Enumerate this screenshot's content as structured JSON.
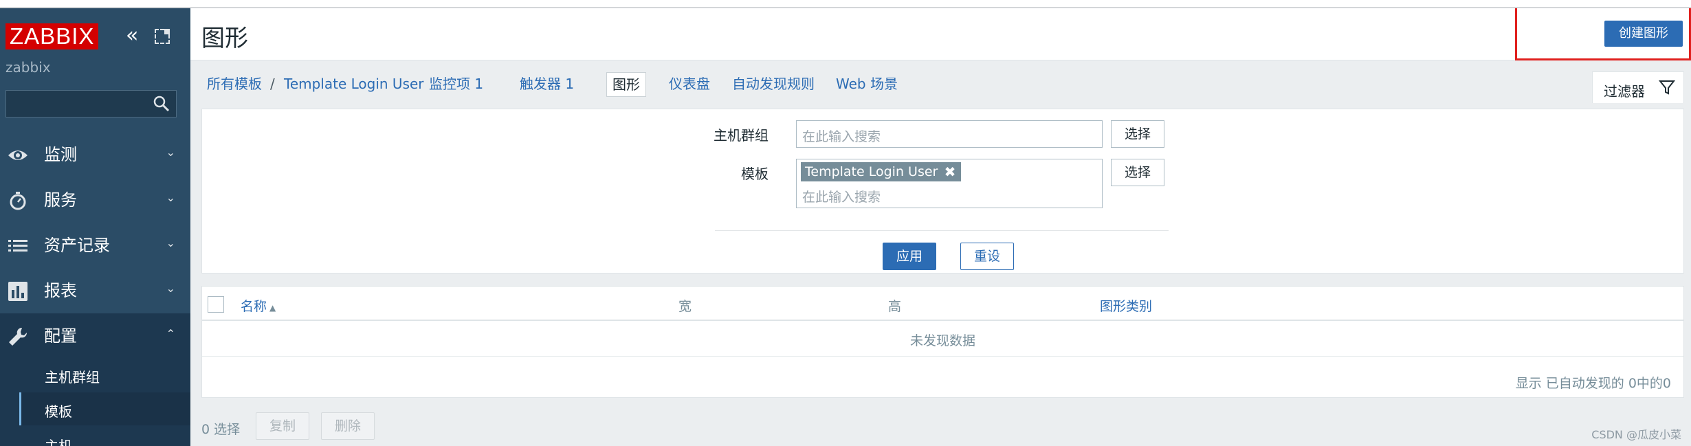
{
  "app": {
    "logo": "ZABBIX",
    "server_name": "zabbix"
  },
  "sidebar": {
    "search_placeholder": "",
    "menu": [
      {
        "label": "监测",
        "icon": "eye-icon"
      },
      {
        "label": "服务",
        "icon": "stopwatch-icon"
      },
      {
        "label": "资产记录",
        "icon": "list-icon"
      },
      {
        "label": "报表",
        "icon": "bar-chart-icon"
      },
      {
        "label": "配置",
        "icon": "wrench-icon"
      }
    ],
    "submenu": [
      {
        "label": "主机群组"
      },
      {
        "label": "模板"
      },
      {
        "label": "主机"
      }
    ]
  },
  "header": {
    "title": "图形",
    "create_label": "创建图形"
  },
  "breadcrumbs": {
    "all_templates": "所有模板",
    "sep": "/",
    "template": "Template Login User",
    "items": "监控项 1",
    "triggers": "触发器 1",
    "graphs": "图形",
    "dashboards": "仪表盘",
    "discovery": "自动发现规则",
    "web": "Web 场景"
  },
  "filter": {
    "tab_label": "过滤器",
    "host_group_label": "主机群组",
    "template_label": "模板",
    "search_placeholder": "在此输入搜索",
    "selected_template": "Template Login User",
    "choose_label": "选择",
    "apply_label": "应用",
    "reset_label": "重设"
  },
  "table": {
    "columns": {
      "name": "名称",
      "width": "宽",
      "height": "高",
      "graph_type": "图形类别"
    },
    "no_data": "未发现数据",
    "summary": "显示 已自动发现的 0中的0"
  },
  "footer": {
    "selected": "0 选择",
    "copy_label": "复制",
    "delete_label": "删除"
  },
  "watermark": "CSDN @瓜皮小菜",
  "colors": {
    "sidebar": "#2b4c66",
    "accent": "#2c6cb4",
    "logo": "#d40000",
    "highlight": "#e0201e"
  }
}
